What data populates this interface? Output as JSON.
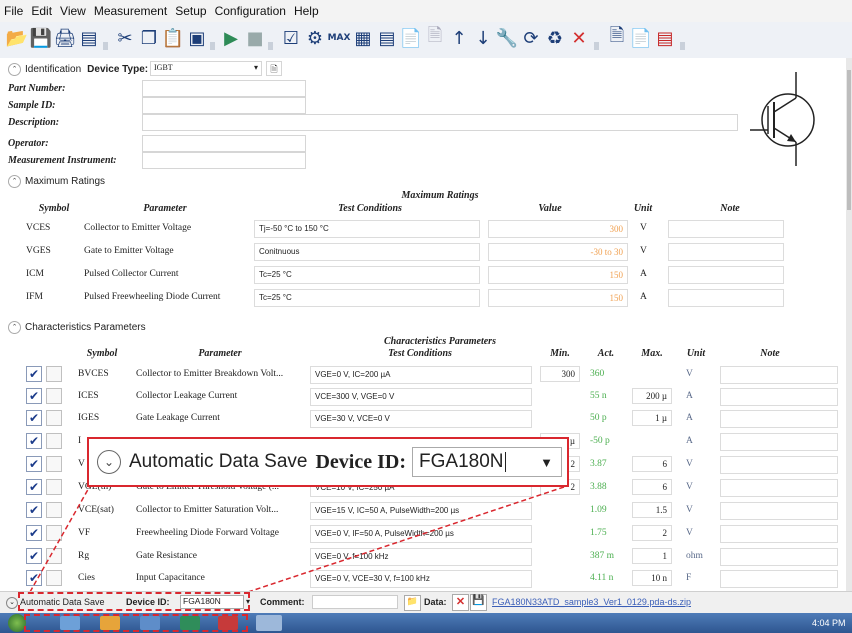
{
  "menu": [
    "File",
    "Edit",
    "View",
    "Measurement",
    "Setup",
    "Configuration",
    "Help"
  ],
  "toolbar": {
    "icons": [
      "open-icon",
      "save-icon",
      "print-icon",
      "export-icon",
      "cut-icon",
      "copy-icon",
      "paste-icon",
      "display-icon",
      "run-icon",
      "stop-icon",
      "checkbox-tool-icon",
      "settings-icon",
      "max-icon",
      "table-icon",
      "chart-icon",
      "report-icon",
      "document-icon",
      "arrow-up-icon",
      "arrow-down-icon",
      "wrench-icon",
      "cycle-icon",
      "recycle-icon",
      "delete-icon",
      "info-icon",
      "page-icon",
      "color-icon"
    ],
    "max_label": "MAX"
  },
  "identification": {
    "section": "Identification",
    "device_type_label": "Device Type:",
    "device_type_value": "IGBT",
    "fields": [
      "Part Number:",
      "Sample ID:",
      "Description:",
      "Operator:",
      "Measurement Instrument:"
    ]
  },
  "max_ratings": {
    "section": "Maximum Ratings",
    "title": "Maximum Ratings",
    "headers": {
      "symbol": "Symbol",
      "parameter": "Parameter",
      "conditions": "Test Conditions",
      "value": "Value",
      "unit": "Unit",
      "note": "Note"
    },
    "rows": [
      {
        "symbol": "VCES",
        "parameter": "Collector to Emitter Voltage",
        "conditions": "Tj=-50 °C to 150 °C",
        "value": "300",
        "unit": "V"
      },
      {
        "symbol": "VGES",
        "parameter": "Gate to Emitter Voltage",
        "conditions": "Conitnuous",
        "value": "-30 to 30",
        "unit": "V"
      },
      {
        "symbol": "ICM",
        "parameter": "Pulsed Collector Current",
        "conditions": "Tc=25 °C",
        "value": "150",
        "unit": "A"
      },
      {
        "symbol": "IFM",
        "parameter": "Pulsed Freewheeling Diode Current",
        "conditions": "Tc=25 °C",
        "value": "150",
        "unit": "A"
      }
    ]
  },
  "char_params": {
    "section": "Characteristics Parameters",
    "title": "Characteristics Parameters",
    "headers": {
      "symbol": "Symbol",
      "parameter": "Parameter",
      "conditions": "Test Conditions",
      "min": "Min.",
      "act": "Act.",
      "max": "Max.",
      "unit": "Unit",
      "note": "Note"
    },
    "rows": [
      {
        "symbol": "BVCES",
        "parameter": "Collector to Emitter Breakdown Volt...",
        "conditions": "VGE=0 V, IC=200 µA",
        "min": "300",
        "act": "360",
        "max": "",
        "unit": "V"
      },
      {
        "symbol": "ICES",
        "parameter": "Collector Leakage Current",
        "conditions": "VCE=300 V, VGE=0 V",
        "min": "",
        "act": "55 n",
        "max": "200 µ",
        "unit": "A"
      },
      {
        "symbol": "IGES",
        "parameter": "Gate Leakage Current",
        "conditions": "VGE=30 V, VCE=0 V",
        "min": "",
        "act": "50 p",
        "max": "1 µ",
        "unit": "A"
      },
      {
        "symbol": "I",
        "parameter": "",
        "conditions": "",
        "min": "µ",
        "act": "-50 p",
        "max": "",
        "unit": "A"
      },
      {
        "symbol": "V",
        "parameter": "",
        "conditions": "",
        "min": "2",
        "act": "3.87",
        "max": "6",
        "unit": "V"
      },
      {
        "symbol": "VGE(th)",
        "parameter": "Gate to Emitter Threshold Voltage (...",
        "conditions": "VCE=10 V, IC=250 µA",
        "min": "2",
        "act": "3.88",
        "max": "6",
        "unit": "V"
      },
      {
        "symbol": "VCE(sat)",
        "parameter": "Collector to Emitter Saturation Volt...",
        "conditions": "VGE=15 V, IC=50 A, PulseWidth=200 µs",
        "min": "",
        "act": "1.09",
        "max": "1.5",
        "unit": "V"
      },
      {
        "symbol": "VF",
        "parameter": "Freewheeling Diode Forward Voltage",
        "conditions": "VGE=0 V, IF=50 A, PulseWidth=200 µs",
        "min": "",
        "act": "1.75",
        "max": "2",
        "unit": "V"
      },
      {
        "symbol": "Rg",
        "parameter": "Gate Resistance",
        "conditions": "VGE=0 V, f=100 kHz",
        "min": "",
        "act": "387 m",
        "max": "1",
        "unit": "ohm"
      },
      {
        "symbol": "Cies",
        "parameter": "Input Capacitance",
        "conditions": "VGE=0 V, VCE=30 V, f=100 kHz",
        "min": "",
        "act": "4.11 n",
        "max": "10 n",
        "unit": "F"
      }
    ]
  },
  "status": {
    "auto_save": "Automatic Data Save",
    "device_id_label": "Device ID:",
    "device_id_value": "FGA180N",
    "comment_label": "Comment:",
    "data_label": "Data:",
    "filename": "FGA180N33ATD_sample3_Ver1_0129.pda-ds.zip"
  },
  "callout": {
    "auto_save": "Automatic Data Save",
    "device_id_label": "Device ID:",
    "device_id_value": "FGA180N"
  },
  "taskbar": {
    "time": "4:04 PM"
  },
  "colors": {
    "accent_red": "#d9272e",
    "value_orange": "#f0a050",
    "act_green": "#4caf50"
  }
}
